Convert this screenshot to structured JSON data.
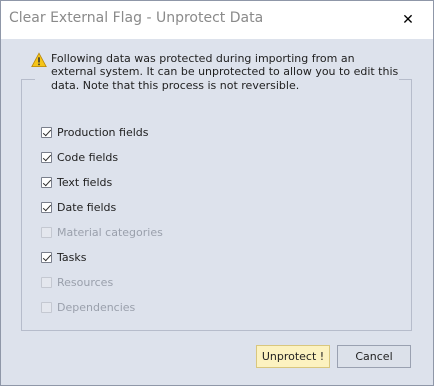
{
  "window": {
    "title": "Clear External Flag - Unprotect Data",
    "close_label": "✕"
  },
  "notice": {
    "icon": "warning-icon",
    "message": "Following data was protected during importing from an external system. It can be unprotected to allow you to edit this data. Note that this process is not reversible."
  },
  "options": [
    {
      "label": "Production fields",
      "checked": true,
      "enabled": true
    },
    {
      "label": "Code fields",
      "checked": true,
      "enabled": true
    },
    {
      "label": "Text fields",
      "checked": true,
      "enabled": true
    },
    {
      "label": "Date fields",
      "checked": true,
      "enabled": true
    },
    {
      "label": "Material categories",
      "checked": false,
      "enabled": false
    },
    {
      "label": "Tasks",
      "checked": true,
      "enabled": true
    },
    {
      "label": "Resources",
      "checked": false,
      "enabled": false
    },
    {
      "label": "Dependencies",
      "checked": false,
      "enabled": false
    }
  ],
  "buttons": {
    "unprotect_label": "Unprotect !",
    "cancel_label": "Cancel"
  },
  "colors": {
    "dialog_bg": "#dde2ec",
    "primary_button_bg": "#fcf2c0",
    "warning_yellow": "#f5c518"
  }
}
